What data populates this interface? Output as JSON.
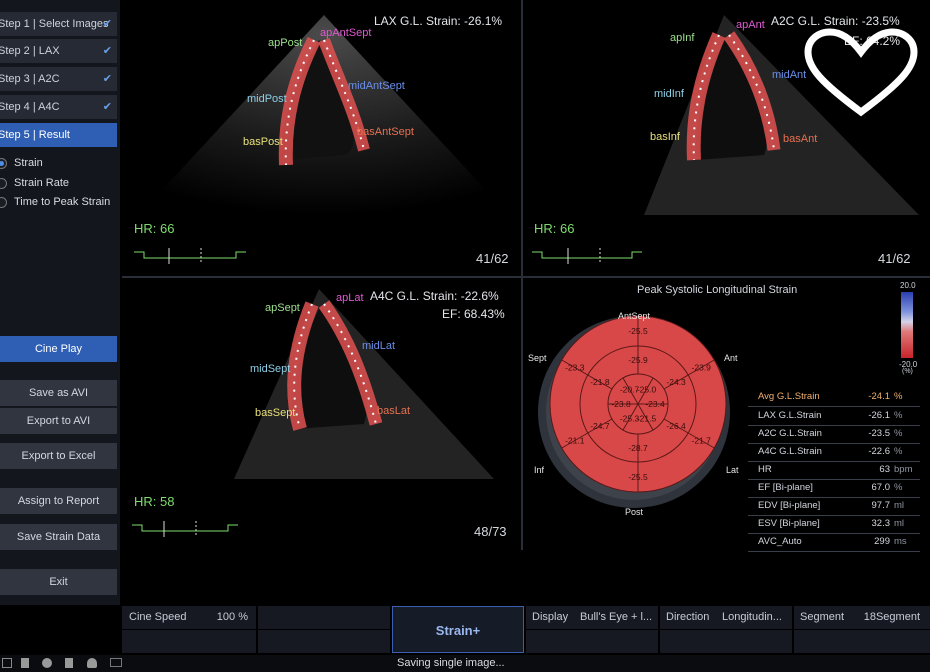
{
  "steps": [
    {
      "label": "Step 1 | Select Images",
      "checked": true,
      "selected": false
    },
    {
      "label": "Step 2 | LAX",
      "checked": true,
      "selected": false
    },
    {
      "label": "Step 3 | A2C",
      "checked": true,
      "selected": false
    },
    {
      "label": "Step 4 | A4C",
      "checked": true,
      "selected": false
    },
    {
      "label": "Step 5 | Result",
      "checked": false,
      "selected": true
    }
  ],
  "options": [
    {
      "label": "Strain",
      "selected": true
    },
    {
      "label": "Strain Rate",
      "selected": false
    },
    {
      "label": "Time to Peak Strain",
      "selected": false
    }
  ],
  "buttons": {
    "cine_play": "Cine Play",
    "save_avi": "Save as AVI",
    "export_avi": "Export to AVI",
    "export_excel": "Export to Excel",
    "assign_report": "Assign to Report",
    "save_strain": "Save Strain Data",
    "exit": "Exit"
  },
  "views": {
    "lax": {
      "title": "LAX G.L. Strain: -26.1%",
      "hr": "HR: 66",
      "frame": "41/62",
      "segments": [
        "apPost",
        "apAntSept",
        "midPost",
        "midAntSept",
        "basPost",
        "basAntSept"
      ]
    },
    "a2c": {
      "title": "A2C G.L. Strain: -23.5%",
      "ef": "EF: 64.2%",
      "hr": "HR: 66",
      "frame": "41/62",
      "segments": [
        "apInf",
        "apAnt",
        "midInf",
        "midAnt",
        "basInf",
        "basAnt"
      ]
    },
    "a4c": {
      "title": "A4C G.L. Strain: -22.6%",
      "ef": "EF: 68.43%",
      "hr": "HR: 58",
      "frame": "48/73",
      "segments": [
        "apSept",
        "apLat",
        "midSept",
        "midLat",
        "basSept",
        "basLat"
      ]
    }
  },
  "bullseye": {
    "title": "Peak Systolic Longitudinal Strain",
    "labels": {
      "top": "AntSept",
      "top_left": "Sept",
      "top_right": "Ant",
      "bottom_left": "Inf",
      "bottom_right": "Lat",
      "bottom": "Post"
    },
    "values": {
      "outer": [
        "-25.5",
        "-23.9",
        "-21.7",
        "-25.5",
        "-21.1",
        "-23.3"
      ],
      "middle": [
        "-25.9",
        "-24.3",
        "-26.4",
        "-28.7",
        "-24.7",
        "-21.8"
      ],
      "inner": [
        "-25.0",
        "-23.4",
        "-21.5",
        "-25.3",
        "-23.8",
        "-20.7"
      ]
    },
    "scale": {
      "max": "20.0",
      "min": "-20.0",
      "unit": "(%)"
    }
  },
  "measurements": [
    {
      "label": "Avg G.L.Strain",
      "value": "-24.1",
      "unit": "%",
      "highlight": true
    },
    {
      "label": "LAX G.L.Strain",
      "value": "-26.1",
      "unit": "%"
    },
    {
      "label": "A2C G.L.Strain",
      "value": "-23.5",
      "unit": "%"
    },
    {
      "label": "A4C G.L.Strain",
      "value": "-22.6",
      "unit": "%"
    },
    {
      "label": "HR",
      "value": "63",
      "unit": "bpm"
    },
    {
      "label": "EF [Bi-plane]",
      "value": "67.0",
      "unit": "%"
    },
    {
      "label": "EDV [Bi-plane]",
      "value": "97.7",
      "unit": "ml"
    },
    {
      "label": "ESV [Bi-plane]",
      "value": "32.3",
      "unit": "ml"
    },
    {
      "label": "AVC_Auto",
      "value": "299",
      "unit": "ms"
    }
  ],
  "bottom_bar": {
    "cine_speed_label": "Cine Speed",
    "cine_speed_value": "100 %",
    "mode": "Strain+",
    "display_label": "Display",
    "display_value": "Bull's Eye + l...",
    "direction_label": "Direction",
    "direction_value": "Longitudin...",
    "segment_label": "Segment",
    "segment_value": "18Segment"
  },
  "status": "Saving single image...",
  "colors": {
    "accent": "#2f5fb5",
    "bullseye_fill": "#d94848",
    "hr_text": "#7fdc6e"
  }
}
